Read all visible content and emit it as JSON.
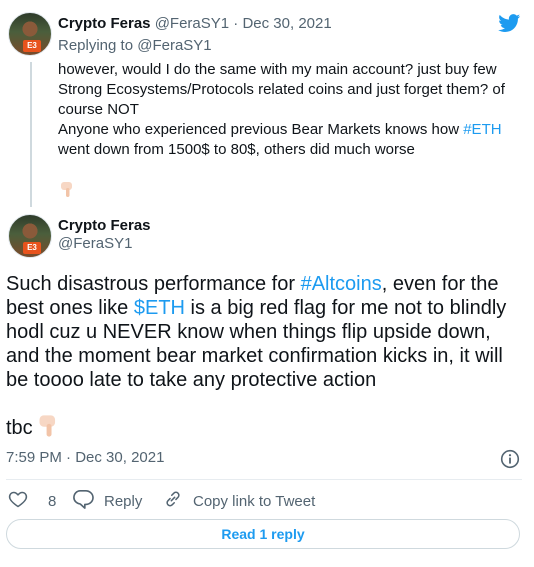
{
  "reply_tweet": {
    "author_name": "Crypto Feras",
    "author_handle": "@FeraSY1",
    "separator": "·",
    "date": "Dec 30, 2021",
    "replying_prefix": "Replying to ",
    "replying_handle": "@FeraSY1",
    "lines": [
      "however, would I do the same with my main account? just buy few",
      "Strong Ecosystems/Protocols related coins and just forget them? of",
      "course NOT"
    ],
    "line4_prefix": "Anyone who experienced previous Bear Markets knows how ",
    "line4_hashtag": "#ETH",
    "line5": "went down from 1500$ to 80$, others did much worse"
  },
  "main_tweet": {
    "author_name": "Crypto Feras",
    "author_handle": "@FeraSY1",
    "text_1": "Such disastrous performance for ",
    "hashtag": "#Altcoins",
    "text_2": ", even for the",
    "text_3": "best ones like ",
    "cashtag": "$ETH",
    "text_4": " is a big red flag for me not to blindly",
    "text_5": "hodl cuz u NEVER know when things flip upside down,",
    "text_6": "and the moment bear market confirmation kicks in, it will",
    "text_7": "be toooo late to take any protective action",
    "tbc": "tbc",
    "time": "7:59 PM",
    "separator": "·",
    "date": "Dec 30, 2021"
  },
  "actions": {
    "like_count": "8",
    "reply_label": "Reply",
    "copy_link_label": "Copy link to Tweet"
  },
  "read_replies_label": "Read 1 reply",
  "avatar_badge": "E3",
  "colors": {
    "link": "#1d9bf0",
    "muted": "#536471",
    "twitter_blue": "#1d9bf0"
  },
  "icons": [
    "twitter-bird-icon",
    "point-down-emoji",
    "info-icon",
    "heart-icon",
    "reply-icon",
    "share-link-icon"
  ]
}
